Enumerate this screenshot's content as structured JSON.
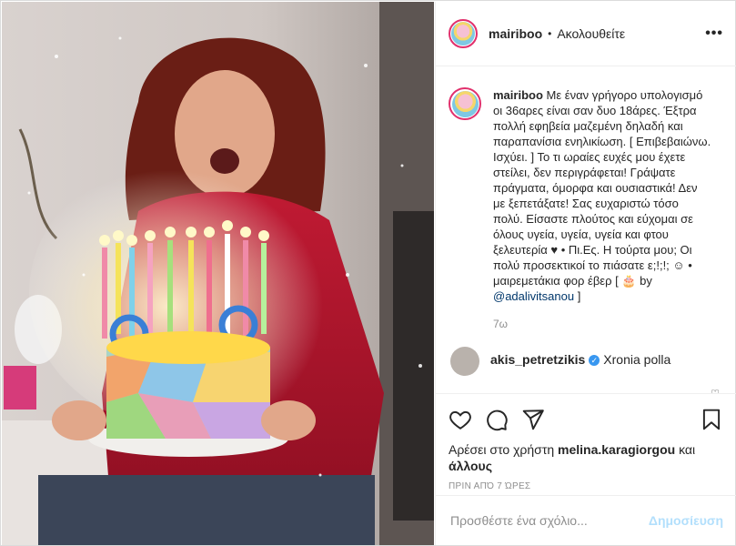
{
  "post": {
    "username": "mairiboo",
    "separator": "•",
    "follow_state": "Ακολουθείτε",
    "more": "•••"
  },
  "caption": {
    "username": "mairiboo",
    "text": "Με έναν γρήγορο υπολογισμό οι 36αρες είναι σαν δυο 18άρες. Έξτρα πολλή εφηβεία μαζεμένη δηλαδή και παραπανίσια ενηλικίωση. [ Επιβεβαιώνω. Ισχύει. ] Το τι ωραίες ευχές μου έχετε στείλει, δεν περιγράφεται! Γράψατε πράγματα, όμορφα και ουσιαστικά! Δεν με ξεπετάξατε! Σας ευχαριστώ τόσο πολύ. Είσαστε πλούτος και εύχομαι σε όλους υγεία, υγεία, υγεία και φτου ξελευτερία ♥ • Πι.Ες. Η τούρτα μου; Οι πολύ προσεκτικοί το πιάσατε ε;!;!; ☺ • μαιρεμετάκια φορ έβερ [ 🎂 by",
    "mention": "@adalivitsanou",
    "closing": " ]",
    "age": "7ω"
  },
  "comment": {
    "username": "akis_petretzikis",
    "verified": "✓",
    "text": "Xronia polla",
    "heart": "♡"
  },
  "likes": {
    "prefix": "Αρέσει στο χρήστη ",
    "user": "melina.karagiorgou",
    "middle": " και",
    "others": "άλλους"
  },
  "timestamp": "ΠΡΙΝ ΑΠΌ 7 ΏΡΕΣ",
  "add_comment": {
    "placeholder": "Προσθέστε ένα σχόλιο...",
    "post_label": "Δημοσίευση"
  },
  "icons": [
    "heart-icon",
    "comment-icon",
    "share-icon",
    "bookmark-icon"
  ],
  "colors": {
    "accent": "#3897f0",
    "post_disabled": "#b2dffc",
    "muted": "#8e8e8e",
    "sweater": "#b3122a"
  }
}
